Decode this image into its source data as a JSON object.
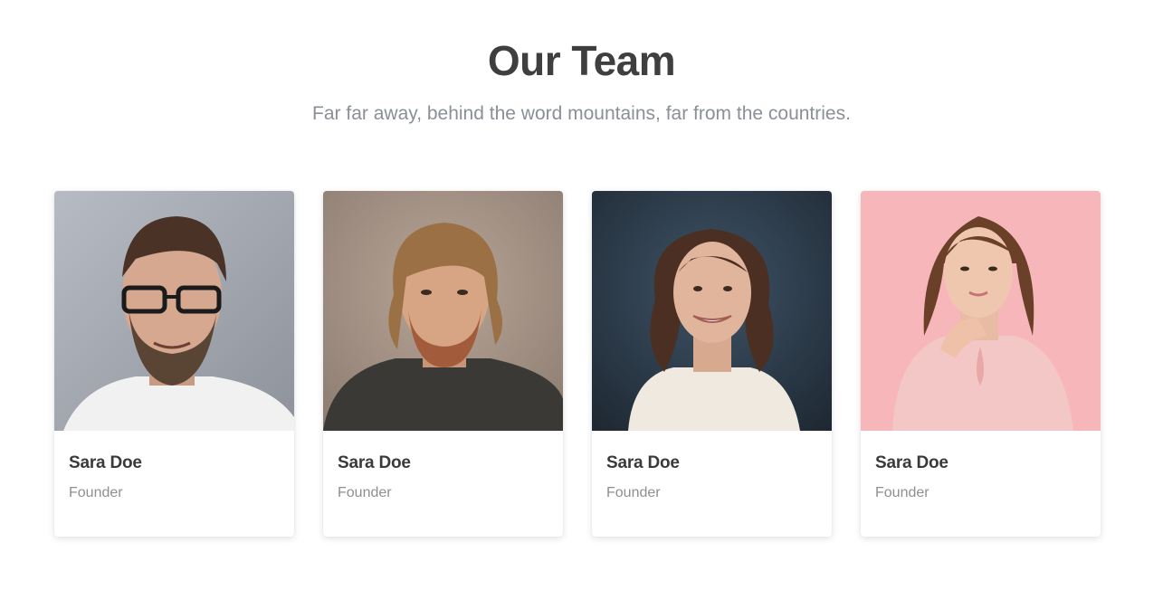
{
  "header": {
    "title": "Our Team",
    "subtitle": "Far far away, behind the word mountains, far from the countries."
  },
  "members": [
    {
      "name": "Sara Doe",
      "role": "Founder",
      "photo_icon": "man-glasses-portrait",
      "bg": "#a9adb5"
    },
    {
      "name": "Sara Doe",
      "role": "Founder",
      "photo_icon": "man-long-hair-portrait",
      "bg": "#9b8a7e"
    },
    {
      "name": "Sara Doe",
      "role": "Founder",
      "photo_icon": "woman-dark-background-portrait",
      "bg": "#2b3a48"
    },
    {
      "name": "Sara Doe",
      "role": "Founder",
      "photo_icon": "woman-pink-background-portrait",
      "bg": "#f6b6b9"
    }
  ]
}
